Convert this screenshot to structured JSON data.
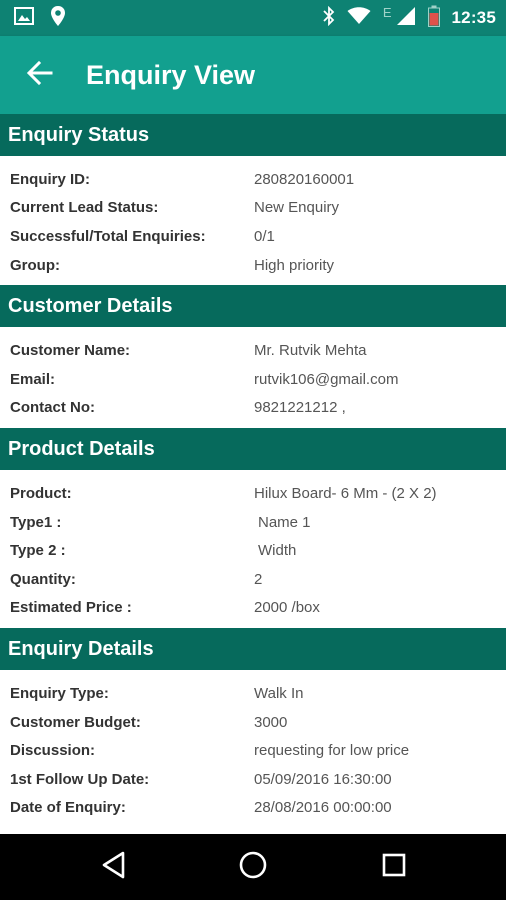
{
  "status_bar": {
    "time": "12:35",
    "network_letter": "E",
    "icons": [
      "image-icon",
      "location-pin-icon",
      "bluetooth-icon",
      "wifi-icon",
      "signal-icon",
      "battery-icon"
    ]
  },
  "app_bar": {
    "title": "Enquiry View",
    "back_icon": "arrow-left-icon"
  },
  "sections": {
    "enquiry_status": {
      "title": "Enquiry Status",
      "rows": [
        {
          "label": "Enquiry ID:",
          "value": "280820160001"
        },
        {
          "label": "Current Lead Status:",
          "value": "New Enquiry"
        },
        {
          "label": "Successful/Total Enquiries:",
          "value": "0/1"
        },
        {
          "label": "Group:",
          "value": "High priority"
        }
      ]
    },
    "customer_details": {
      "title": "Customer Details",
      "rows": [
        {
          "label": "Customer Name:",
          "value": "Mr. Rutvik Mehta"
        },
        {
          "label": "Email:",
          "value": "rutvik106@gmail.com"
        },
        {
          "label": "Contact No:",
          "value": "9821221212 ,"
        }
      ]
    },
    "product_details": {
      "title": "Product Details",
      "rows": [
        {
          "label": "Product:",
          "value": "Hilux Board- 6 Mm - (2 X 2)"
        },
        {
          "label": "Type1 :",
          "value": "Name 1"
        },
        {
          "label": "Type 2 :",
          "value": "Width"
        },
        {
          "label": "Quantity:",
          "value": "2"
        },
        {
          "label": "Estimated Price :",
          "value": "2000 /box"
        }
      ]
    },
    "enquiry_details": {
      "title": "Enquiry Details",
      "rows": [
        {
          "label": "Enquiry Type:",
          "value": "Walk In"
        },
        {
          "label": "Customer Budget:",
          "value": "3000"
        },
        {
          "label": "Discussion:",
          "value": "requesting for low price"
        },
        {
          "label": "1st Follow Up Date:",
          "value": "05/09/2016 16:30:00"
        },
        {
          "label": "Date of Enquiry:",
          "value": "28/08/2016 00:00:00"
        }
      ]
    }
  },
  "nav_bar": {
    "icons": [
      "back-triangle-icon",
      "home-circle-icon",
      "recents-square-icon"
    ]
  },
  "colors": {
    "status_bar": "#0e8273",
    "app_bar": "#12a08f",
    "section_header": "#066a5c",
    "nav_bar": "#000000"
  }
}
